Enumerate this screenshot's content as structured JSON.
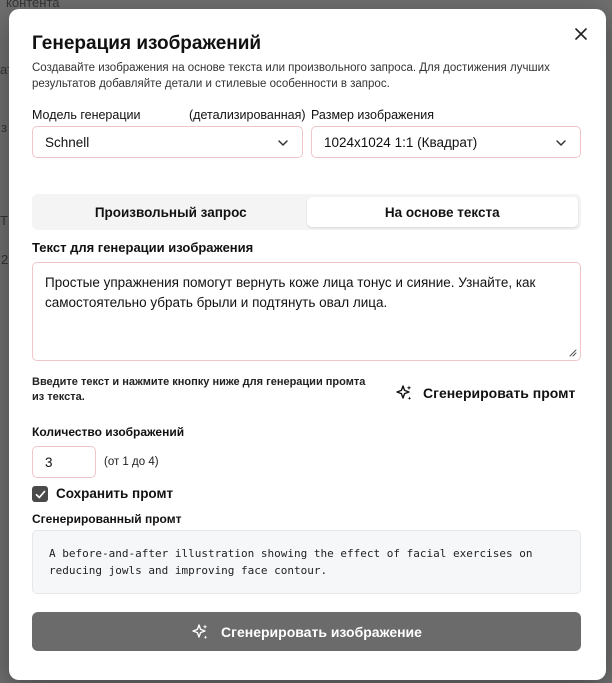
{
  "backdrop": {
    "fragment_1": "контента",
    "fragment_2": "ать",
    "fragment_3": "з",
    "fragment_4": "Т",
    "fragment_5": "2"
  },
  "modal": {
    "title": "Генерация изображений",
    "subtitle": "Создавайте изображения на основе текста или произвольного запроса. Для достижения лучших результатов добавляйте детали и стилевые особенности в запрос.",
    "close_icon": "close-icon"
  },
  "model": {
    "label": "Модель генерации",
    "label_note": "(детализированная)",
    "value": "Schnell"
  },
  "size": {
    "label": "Размер изображения",
    "value": "1024x1024 1:1 (Квадрат)"
  },
  "tabs": [
    {
      "label": "Произвольный запрос",
      "active": false
    },
    {
      "label": "На основе текста",
      "active": true
    }
  ],
  "text_input": {
    "label": "Текст для генерации изображения",
    "value": "Простые упражнения помогут вернуть коже лица тонус и сияние. Узнайте, как самостоятельно убрать брыли и подтянуть овал лица."
  },
  "hint": "Введите текст и нажмите кнопку ниже для генерации промта из текста.",
  "generate_prompt_button": {
    "label": "Сгенерировать промт",
    "icon": "sparkles-icon"
  },
  "count": {
    "label": "Количество изображений",
    "value": "3",
    "range_note": "(от 1 до 4)"
  },
  "save_prompt": {
    "label": "Сохранить промт",
    "checked": true
  },
  "generated_prompt": {
    "label": "Сгенерированный промт",
    "value": "A before-and-after illustration showing the effect of facial exercises on reducing jowls and improving face contour."
  },
  "generate_image_button": {
    "label": "Сгенерировать изображение",
    "icon": "sparkles-icon"
  },
  "colors": {
    "overlay": "#6f6f6f",
    "field_border": "#f0c6cb",
    "primary_button": "#6b6b6b",
    "checkbox": "#4a4a4a"
  }
}
